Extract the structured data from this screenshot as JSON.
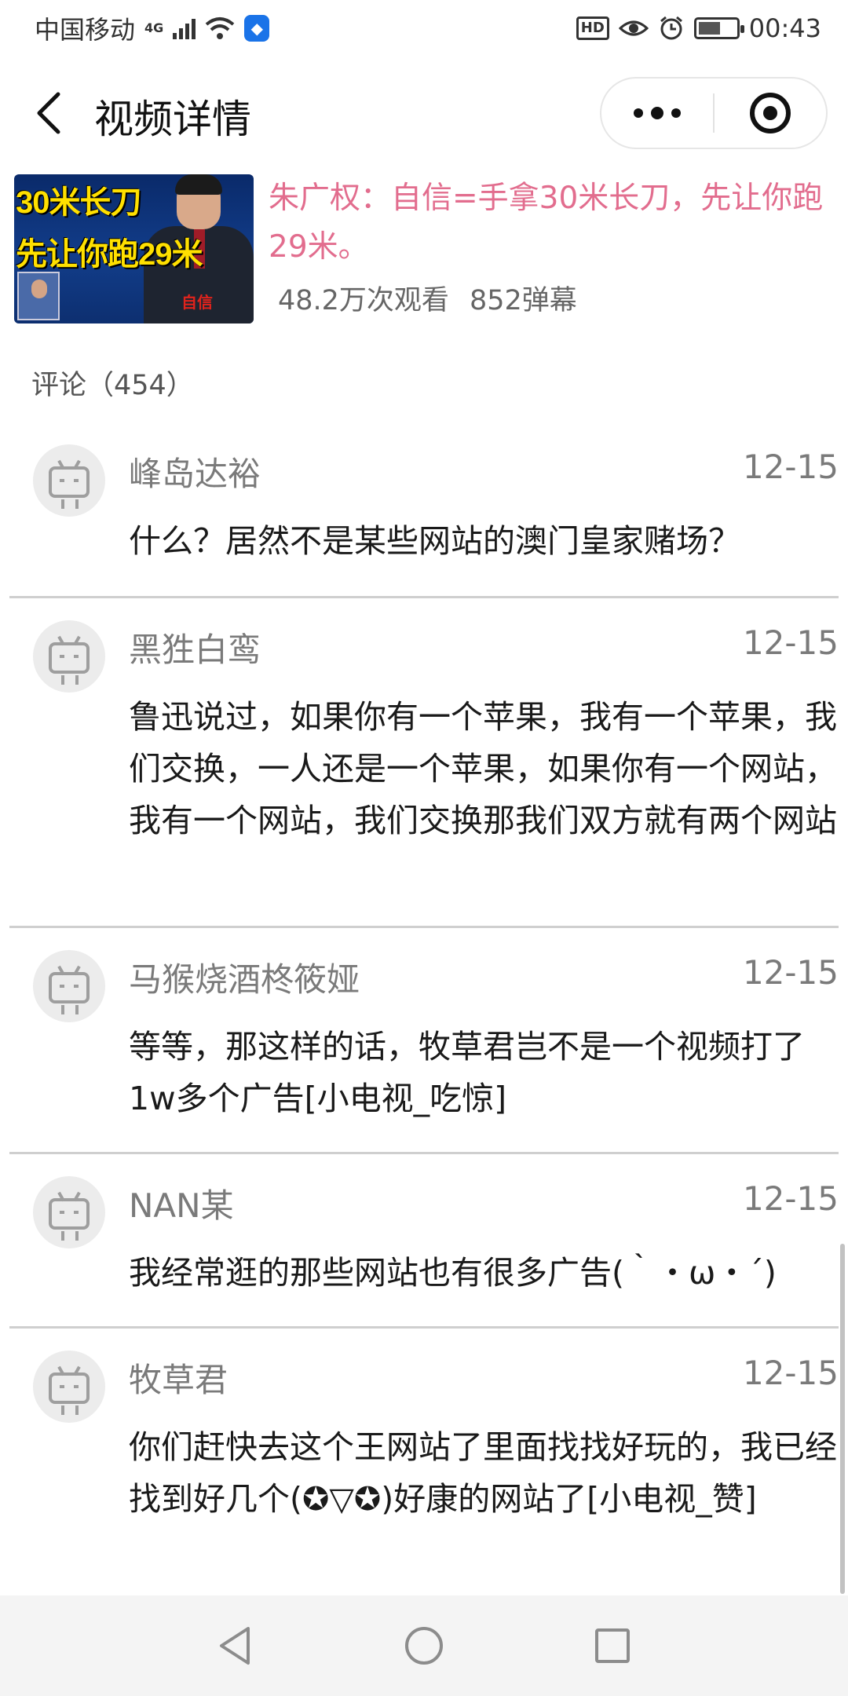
{
  "status_bar": {
    "carrier": "中国移动",
    "network": "4G",
    "time": "00:43",
    "hd": "HD",
    "battery_level": 0.6
  },
  "header": {
    "title": "视频详情"
  },
  "video": {
    "thumbnail_text_1": "30米长刀",
    "thumbnail_text_2": "先让你跑29米",
    "thumbnail_badge": "自信",
    "title": "朱广权：自信=手拿30米长刀，先让你跑29米。",
    "views": "48.2万次观看",
    "danmaku": "852弹幕"
  },
  "comments_header": "评论（454）",
  "comments": [
    {
      "name": "峰岛达裕",
      "date": "12-15",
      "text": "什么？居然不是某些网站的澳门皇家赌场？"
    },
    {
      "name": "黑狌白鸾",
      "date": "12-15",
      "text": "鲁迅说过，如果你有一个苹果，我有一个苹果，我们交换，一人还是一个苹果，如果你有一个网站，我有一个网站，我们交换那我们双方就有两个网站"
    },
    {
      "name": "马猴烧酒柊筱娅",
      "date": "12-15",
      "text": "等等，那这样的话，牧草君岂不是一个视频打了1w多个广告[小电视_吃惊]"
    },
    {
      "name": "NAN某",
      "date": "12-15",
      "text": "我经常逛的那些网站也有很多广告(｀・ω・´)"
    },
    {
      "name": "牧草君",
      "date": "12-15",
      "text": "你们赶快去这个王网站了里面找找好玩的，我已经找到好几个(✪▽✪)好康的网站了[小电视_赞]"
    }
  ],
  "colors": {
    "video_title": "#e26d8e",
    "divider": "#cfcfcf",
    "meta": "#7a7a7a"
  },
  "icons": [
    "back-icon",
    "more-icon",
    "close-miniprogram-icon",
    "tv-avatar-icon",
    "nav-back-icon",
    "nav-home-icon",
    "nav-recents-icon"
  ]
}
